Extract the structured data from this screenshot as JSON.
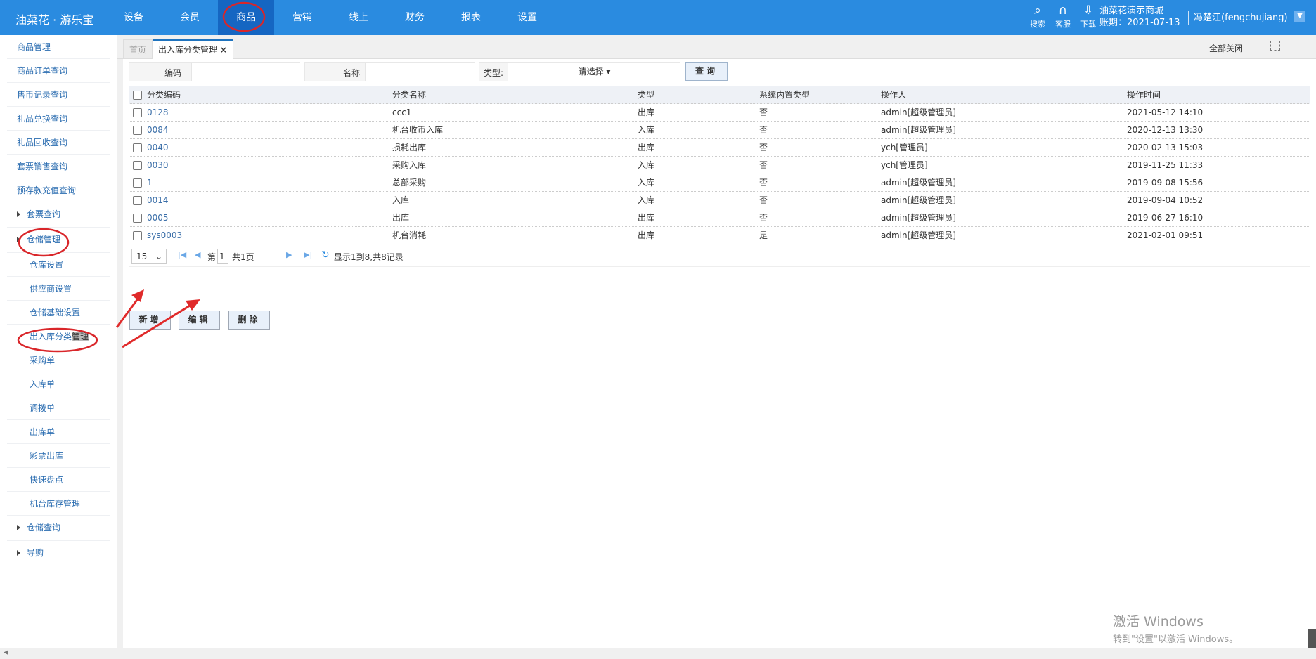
{
  "header": {
    "logo": "油菜花 · 游乐宝",
    "nav": [
      "设备",
      "会员",
      "商品",
      "营销",
      "线上",
      "财务",
      "报表",
      "设置"
    ],
    "active_nav": "商品",
    "tools": [
      {
        "icon": "search-icon",
        "label": "搜索"
      },
      {
        "icon": "headset-icon",
        "label": "客服"
      },
      {
        "icon": "download-icon",
        "label": "下载"
      }
    ],
    "shop": "油菜花演示商城",
    "account_date": "账期：2021-07-13",
    "user": "冯楚江(fengchujiang)",
    "accent": "#2a8be0"
  },
  "sidebar": {
    "items": [
      {
        "label": "商品管理",
        "kind": "item"
      },
      {
        "label": "商品订单查询",
        "kind": "item"
      },
      {
        "label": "售币记录查询",
        "kind": "item"
      },
      {
        "label": "礼品兑换查询",
        "kind": "item"
      },
      {
        "label": "礼品回收查询",
        "kind": "item"
      },
      {
        "label": "套票销售查询",
        "kind": "item"
      },
      {
        "label": "预存款充值查询",
        "kind": "item"
      },
      {
        "label": "套票查询",
        "kind": "group"
      },
      {
        "label": "仓储管理",
        "kind": "group"
      },
      {
        "label": "仓库设置",
        "kind": "sub"
      },
      {
        "label": "供应商设置",
        "kind": "sub"
      },
      {
        "label": "仓储基础设置",
        "kind": "sub"
      },
      {
        "label": "出入库分类管理",
        "kind": "sub"
      },
      {
        "label": "采购单",
        "kind": "sub"
      },
      {
        "label": "入库单",
        "kind": "sub"
      },
      {
        "label": "调拨单",
        "kind": "sub"
      },
      {
        "label": "出库单",
        "kind": "sub"
      },
      {
        "label": "彩票出库",
        "kind": "sub"
      },
      {
        "label": "快速盘点",
        "kind": "sub"
      },
      {
        "label": "机台库存管理",
        "kind": "sub"
      },
      {
        "label": "仓储查询",
        "kind": "group"
      },
      {
        "label": "导购",
        "kind": "group"
      }
    ],
    "collapse": "‹"
  },
  "tabs": {
    "home": "首页",
    "current": "出入库分类管理",
    "close": "×",
    "close_all": "全部关闭"
  },
  "search": {
    "code_label": "编码",
    "code_value": "",
    "name_label": "名称",
    "name_value": "",
    "type_label": "类型:",
    "type_value": "请选择 ▾",
    "query": "查询"
  },
  "table": {
    "columns": [
      "分类编码",
      "分类名称",
      "类型",
      "系统内置类型",
      "操作人",
      "操作时间"
    ],
    "rows": [
      [
        "0128",
        "ccc1",
        "出库",
        "否",
        "admin[超级管理员]",
        "2021-05-12 14:10"
      ],
      [
        "0084",
        "机台收币入库",
        "入库",
        "否",
        "admin[超级管理员]",
        "2020-12-13 13:30"
      ],
      [
        "0040",
        "损耗出库",
        "出库",
        "否",
        "ych[管理员]",
        "2020-02-13 15:03"
      ],
      [
        "0030",
        "采购入库",
        "入库",
        "否",
        "ych[管理员]",
        "2019-11-25 11:33"
      ],
      [
        "1",
        "总部采购",
        "入库",
        "否",
        "admin[超级管理员]",
        "2019-09-08 15:56"
      ],
      [
        "0014",
        "入库",
        "入库",
        "否",
        "admin[超级管理员]",
        "2019-09-04 10:52"
      ],
      [
        "0005",
        "出库",
        "出库",
        "否",
        "admin[超级管理员]",
        "2019-06-27 16:10"
      ],
      [
        "sys0003",
        "机台消耗",
        "出库",
        "是",
        "admin[超级管理员]",
        "2021-02-01 09:51"
      ]
    ]
  },
  "pager": {
    "page_size": "15",
    "page_prefix": "第",
    "page": "1",
    "page_total": "共1页",
    "summary": "显示1到8,共8记录"
  },
  "actions": {
    "add": "新增",
    "edit": "编辑",
    "delete": "删除"
  },
  "watermark": {
    "line1": "激活 Windows",
    "line2": "转到\"设置\"以激活 Windows。"
  }
}
